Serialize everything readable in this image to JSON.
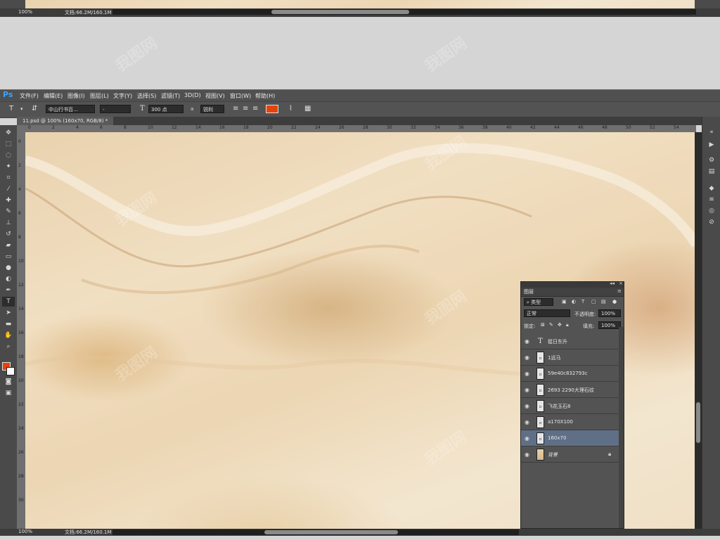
{
  "top_status": {
    "zoom": "100%",
    "doc_info": "文档:66.2M/160.1M"
  },
  "app": {
    "logo": "Ps",
    "menus": [
      "文件(F)",
      "编辑(E)",
      "图像(I)",
      "图层(L)",
      "文字(Y)",
      "选择(S)",
      "滤镜(T)",
      "3D(D)",
      "视图(V)",
      "窗口(W)",
      "帮助(H)"
    ]
  },
  "options_bar": {
    "tool_icon": "text-tool-icon",
    "orientation_icon": "text-orientation-icon",
    "font_family": "中山行书百...",
    "font_style": "-",
    "font_size_icon": "T",
    "font_size": "300 点",
    "aa_label": "a",
    "anti_alias": "锐利",
    "text_color": "#e8420c"
  },
  "document": {
    "tab_title": "11.psd @ 100% (160x70, RGB/8) *",
    "ruler_top_ticks": [
      "0",
      "2",
      "4",
      "6",
      "8",
      "10",
      "12",
      "14",
      "16",
      "18",
      "20",
      "22",
      "24",
      "26",
      "28",
      "30",
      "32",
      "34",
      "36",
      "38",
      "40",
      "42",
      "44",
      "46",
      "48",
      "50",
      "52",
      "54"
    ],
    "ruler_left_ticks": [
      "0",
      "2",
      "4",
      "6",
      "8",
      "10",
      "12",
      "14",
      "16",
      "18",
      "20",
      "22",
      "24",
      "26",
      "28",
      "30"
    ]
  },
  "colors": {
    "foreground": "#e8420c",
    "background": "#ffffff"
  },
  "layers_panel": {
    "title": "图层",
    "filter_kind": "类型",
    "blend_mode": "正常",
    "opacity_label": "不透明度:",
    "opacity_value": "100%",
    "lock_label": "锁定:",
    "fill_label": "填充:",
    "fill_value": "100%",
    "layers": [
      {
        "name": "挺日东升",
        "kind": "text",
        "selected": false
      },
      {
        "name": "1远马",
        "kind": "smart",
        "selected": false
      },
      {
        "name": "59e40c832793c",
        "kind": "smart",
        "selected": false
      },
      {
        "name": "2693 2290大理石纹",
        "kind": "smart",
        "selected": false
      },
      {
        "name": "飞花玉石8",
        "kind": "smart",
        "selected": false
      },
      {
        "name": "a170X100",
        "kind": "smart",
        "selected": false
      },
      {
        "name": "160x70",
        "kind": "smart",
        "selected": true
      },
      {
        "name": "背景",
        "kind": "background",
        "selected": false,
        "locked": true
      }
    ]
  },
  "bottom_status": {
    "zoom": "100%",
    "doc_info": "文档:66.2M/160.1M"
  },
  "watermark": "我图网"
}
